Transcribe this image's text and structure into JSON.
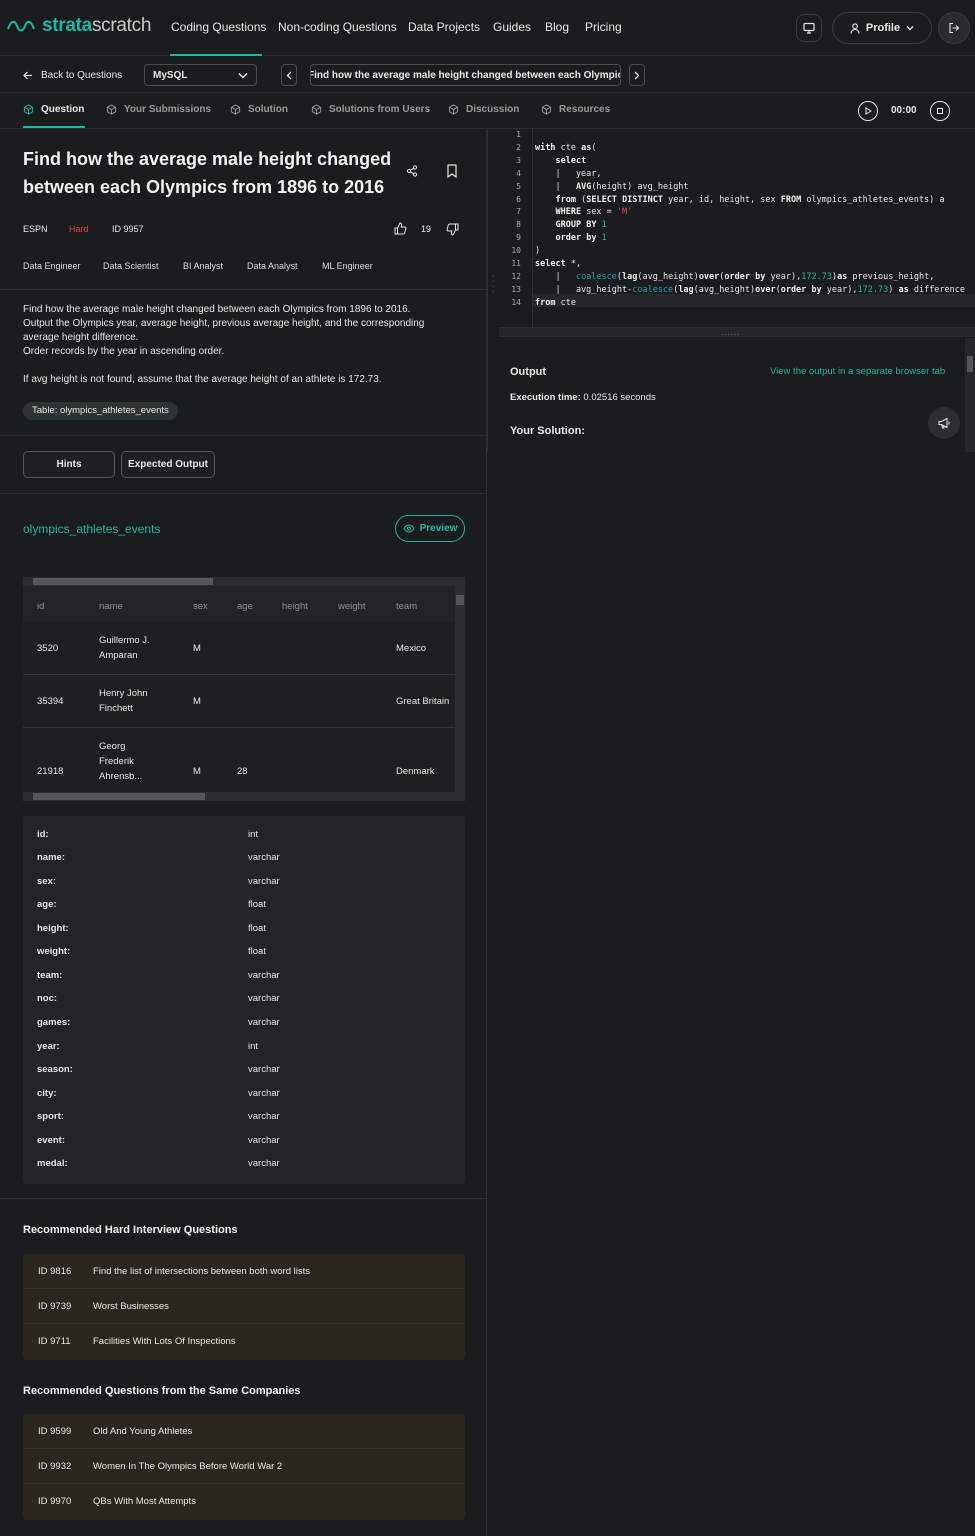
{
  "brand": {
    "bold": "strata",
    "light": "scratch"
  },
  "nav": {
    "links": [
      "Coding Questions",
      "Non-coding Questions",
      "Data Projects",
      "Guides",
      "Blog",
      "Pricing"
    ],
    "profile": "Profile"
  },
  "subbar": {
    "back": "Back to Questions",
    "language": "MySQL",
    "question_title": "Find how the average male height changed between each Olympic"
  },
  "tabs": [
    "Question",
    "Your Submissions",
    "Solution",
    "Solutions from Users",
    "Discussion",
    "Resources"
  ],
  "timer": "00:00",
  "question": {
    "title": "Find how the average male height changed between each Olympics from 1896 to 2016",
    "company": "ESPN",
    "difficulty": "Hard",
    "id": "ID 9957",
    "votes": "19",
    "roles": [
      "Data Engineer",
      "Data Scientist",
      "BI Analyst",
      "Data Analyst",
      "ML Engineer"
    ],
    "desc": [
      "Find how the average male height changed between each Olympics from 1896 to 2016.",
      "Output the Olympics year, average height, previous average height, and the corresponding average height difference.",
      "Order records by the year in ascending order.",
      "",
      "If avg height is not found, assume that the average height of an athlete is 172.73."
    ],
    "table_chip": "Table: olympics_athletes_events"
  },
  "buttons": {
    "hints": "Hints",
    "expected": "Expected Output",
    "preview": "Preview"
  },
  "table_name": "olympics_athletes_events",
  "grid": {
    "headers": [
      "id",
      "name",
      "sex",
      "age",
      "height",
      "weight",
      "team"
    ],
    "rows": [
      {
        "id": "3520",
        "name": "Guillermo J. Amparan",
        "sex": "M",
        "age": "",
        "height": "",
        "weight": "",
        "team": "Mexico"
      },
      {
        "id": "35394",
        "name": "Henry John Finchett",
        "sex": "M",
        "age": "",
        "height": "",
        "weight": "",
        "team": "Great Britain"
      },
      {
        "id": "21918",
        "name": "Georg Frederik Ahrensb...",
        "sex": "M",
        "age": "28",
        "height": "",
        "weight": "",
        "team": "Denmark"
      }
    ]
  },
  "schema": [
    {
      "k": "id:",
      "v": "int"
    },
    {
      "k": "name:",
      "v": "varchar"
    },
    {
      "k": "sex:",
      "v": "varchar"
    },
    {
      "k": "age:",
      "v": "float"
    },
    {
      "k": "height:",
      "v": "float"
    },
    {
      "k": "weight:",
      "v": "float"
    },
    {
      "k": "team:",
      "v": "varchar"
    },
    {
      "k": "noc:",
      "v": "varchar"
    },
    {
      "k": "games:",
      "v": "varchar"
    },
    {
      "k": "year:",
      "v": "int"
    },
    {
      "k": "season:",
      "v": "varchar"
    },
    {
      "k": "city:",
      "v": "varchar"
    },
    {
      "k": "sport:",
      "v": "varchar"
    },
    {
      "k": "event:",
      "v": "varchar"
    },
    {
      "k": "medal:",
      "v": "varchar"
    }
  ],
  "rec_hard": {
    "title": "Recommended Hard Interview Questions",
    "items": [
      {
        "id": "ID 9816",
        "t": "Find the list of intersections between both word lists"
      },
      {
        "id": "ID 9739",
        "t": "Worst Businesses"
      },
      {
        "id": "ID 9711",
        "t": "Facilities With Lots Of Inspections"
      }
    ]
  },
  "rec_same": {
    "title": "Recommended Questions from the Same Companies",
    "items": [
      {
        "id": "ID 9599",
        "t": "Old And Young Athletes"
      },
      {
        "id": "ID 9932",
        "t": "Women In The Olympics Before World War 2"
      },
      {
        "id": "ID 9970",
        "t": "QBs With Most Attempts"
      }
    ]
  },
  "code_lines": [
    "",
    "with cte as(",
    "    select",
    "    |   year,",
    "    |   AVG(height) avg_height",
    "    from (SELECT DISTINCT year, id, height, sex FROM olympics_athletes_events) a",
    "    WHERE sex = 'M'",
    "    GROUP BY 1",
    "    order by 1",
    ")",
    "select *,",
    "    |   coalesce(lag(avg_height)over(order by year),172.73)as previous_height,",
    "    |   avg_height-coalesce(lag(avg_height)over(order by year),172.73) as difference",
    "from cte"
  ],
  "output": {
    "title": "Output",
    "link": "View the output in a separate browser tab",
    "exec_label": "Execution time:",
    "exec_value": "0.02516 seconds",
    "your_solution": "Your Solution:"
  },
  "colors": {
    "accent": "#21b5a6",
    "hard": "#e0463c",
    "bg": "#1b1c1e"
  }
}
